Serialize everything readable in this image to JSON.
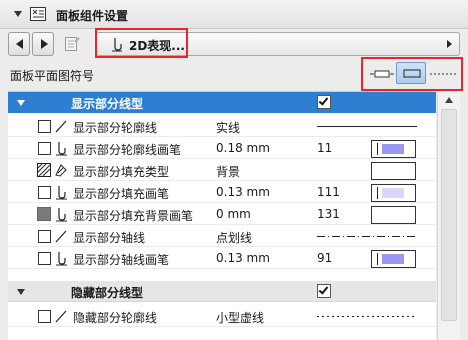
{
  "panel": {
    "title": "面板组件设置"
  },
  "nav": {
    "current_page": "2D表现..."
  },
  "symbol": {
    "label": "面板平面图符号"
  },
  "groups": [
    {
      "label": "显示部分线型",
      "checked": true
    },
    {
      "label": "隐藏部分线型",
      "checked": true
    }
  ],
  "rows": [
    {
      "name": "显示部分轮廓线",
      "value": "实线",
      "num": ""
    },
    {
      "name": "显示部分轮廓线画笔",
      "value": "0.18 mm",
      "num": "11"
    },
    {
      "name": "显示部分填充类型",
      "value": "背景",
      "num": ""
    },
    {
      "name": "显示部分填充画笔",
      "value": "0.13 mm",
      "num": "111"
    },
    {
      "name": "显示部分填充背景画笔",
      "value": "0 mm",
      "num": "131"
    },
    {
      "name": "显示部分轴线",
      "value": "点划线",
      "num": ""
    },
    {
      "name": "显示部分轴线画笔",
      "value": "0.13 mm",
      "num": "91"
    },
    {
      "name": "隐藏部分轮廓线",
      "value": "小型虚线",
      "num": ""
    }
  ],
  "colors": {
    "selection": "#2e7fd2",
    "highlight": "#e8262a",
    "pen_swatch": "#9a98f2",
    "pen_swatch_light": "#d8d7fa"
  }
}
